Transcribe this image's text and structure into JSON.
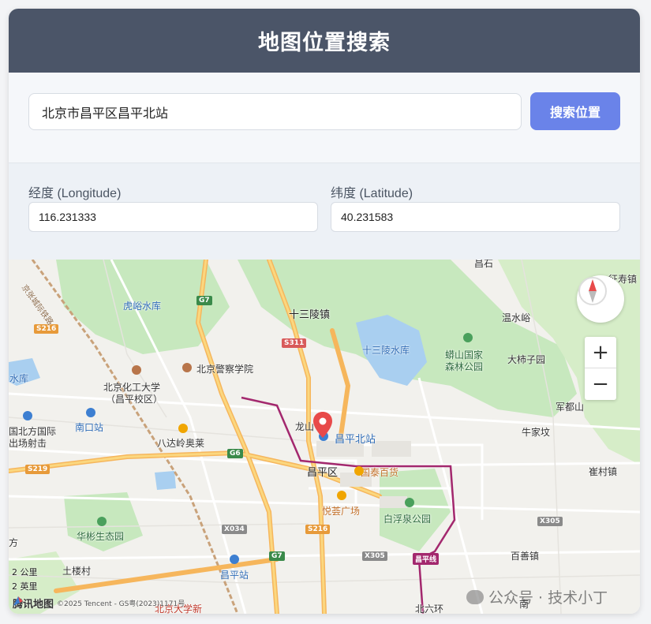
{
  "header": {
    "title": "地图位置搜索"
  },
  "search": {
    "value": "北京市昌平区昌平北站",
    "button_label": "搜索位置"
  },
  "coords": {
    "longitude_label": "经度 (Longitude)",
    "longitude_value": "116.231333",
    "latitude_label": "纬度 (Latitude)",
    "latitude_value": "40.231583"
  },
  "map": {
    "labels": {
      "shisanling_town": "十三陵镇",
      "huyu_reservoir": "虎峪水库",
      "shisanling_reservoir": "十三陵水库",
      "mangshan": "蟒山国家森林公园",
      "mangshan_1": "蟒山国家",
      "mangshan_2": "森林公园",
      "wenshuiyu": "温水峪",
      "dashizi": "大柿子园",
      "police_college": "北京警察学院",
      "bhu_1": "北京化工大学",
      "bhu_2": "（昌平校区）",
      "shuiku": "水库",
      "longshan": "龙山",
      "station": "昌平北站",
      "nankou": "南口站",
      "badaling": "八达岭奥莱",
      "intl_1": "国北方国际",
      "intl_2": "出场射击",
      "junduoshan": "军都山",
      "niujiawu": "牛家坟",
      "changping_district": "昌平区",
      "guotai": "国泰百货",
      "cuncun": "崔村镇",
      "yuehui": "悦荟广场",
      "baifuquan": "白浮泉公园",
      "huabin": "华彬生态园",
      "tulou": "土楼村",
      "changping_station": "昌平站",
      "baishan": "百善镇",
      "beiliuhuan": "北六环",
      "fang": "方",
      "zhengshou": "征寿镇",
      "nanzhuangjian": "南",
      "cpu": "北京大学新",
      "top_text": "昌石"
    },
    "road_signs": {
      "g7_a": "G7",
      "s216_a": "S216",
      "s311": "S311",
      "g6": "G6",
      "s219": "S219",
      "x034": "X034",
      "s216_b": "S216",
      "x305_a": "X305",
      "x305_b": "X305",
      "g7_b": "G7",
      "line": "昌平线"
    },
    "highway_text": "京张城际铁路",
    "scale_km": "2 公里",
    "scale_mi": "2 英里",
    "brand": "腾讯地图",
    "copyright": "©2025 Tencent - GS粤(2023)1171号",
    "watermark": "公众号 · 技术小丁"
  },
  "colors": {
    "header_bg": "#4b5568",
    "button_bg": "#6a83e9",
    "park_green": "#c7e8be",
    "water": "#a9cff0",
    "highway": "#f6b65c",
    "metro": "#a3286e",
    "marker": "#e84a4a"
  }
}
